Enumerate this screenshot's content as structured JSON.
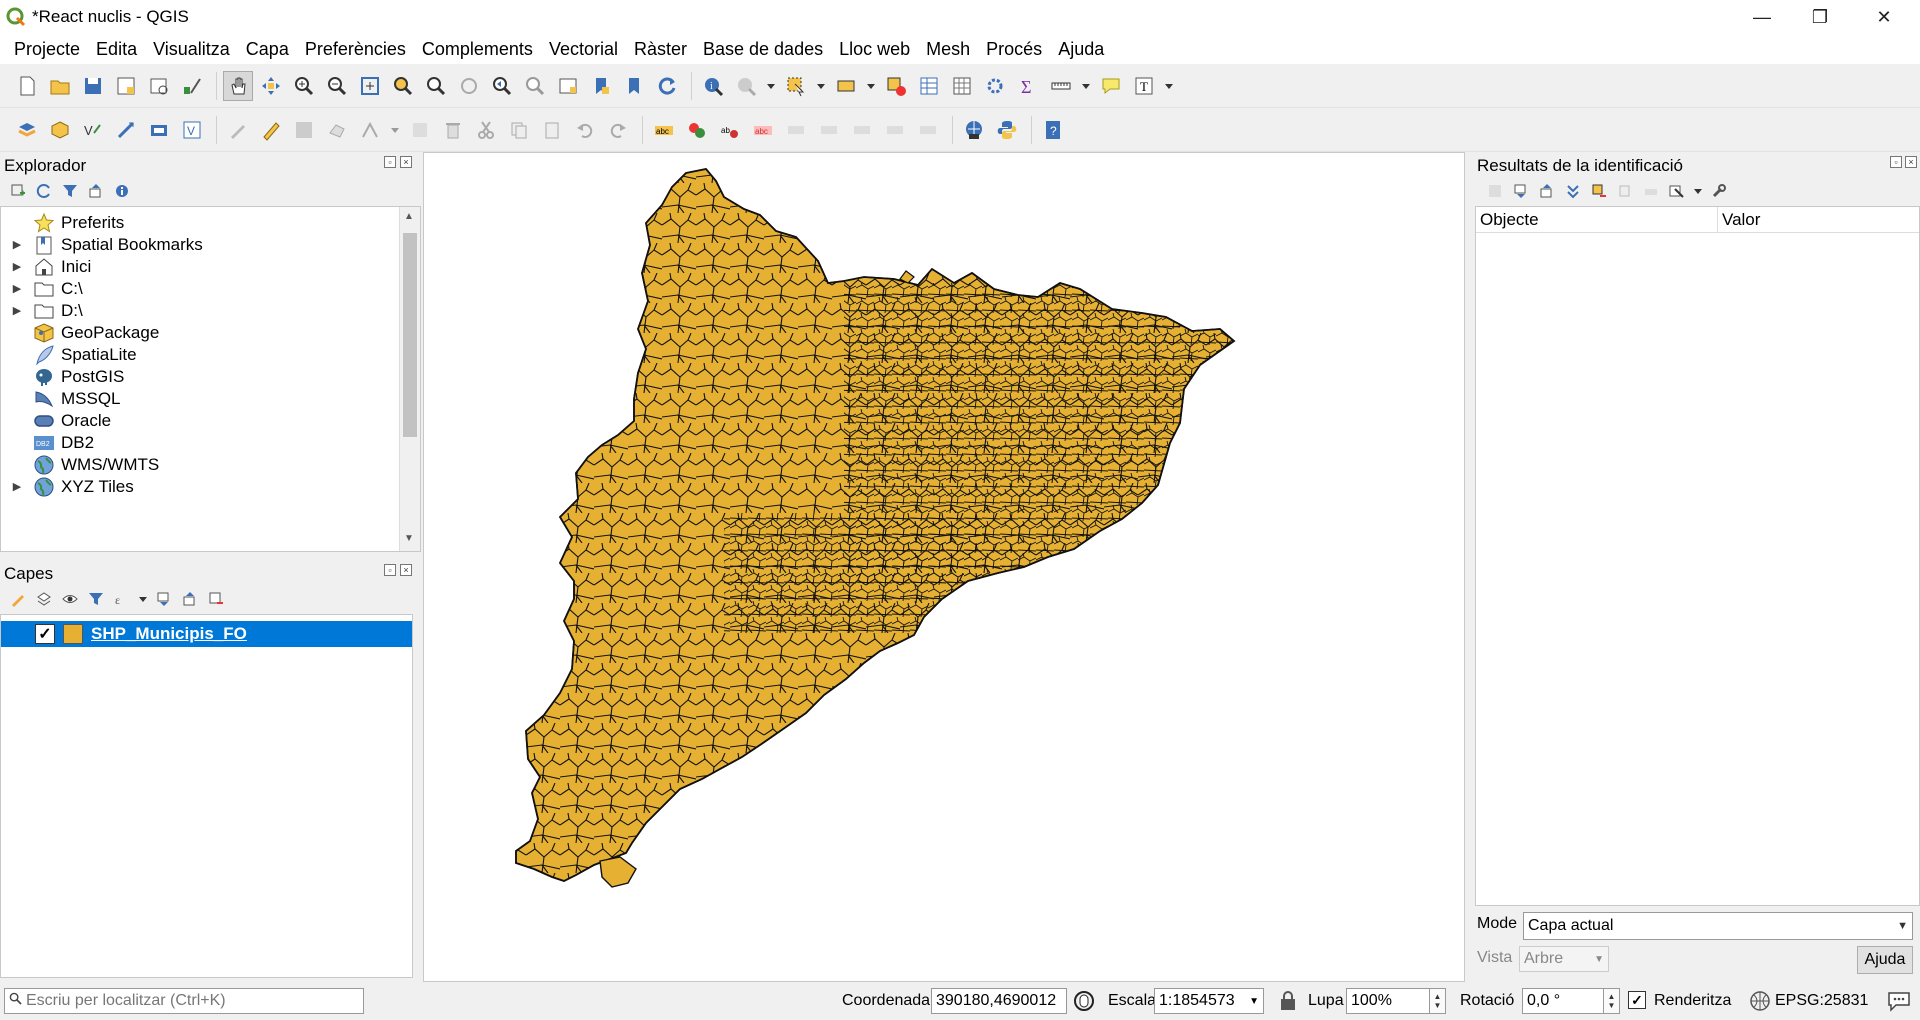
{
  "window": {
    "title": "*React nuclis - QGIS",
    "minimize": "—",
    "maximize": "❐",
    "close": "✕"
  },
  "menu": [
    "Projecte",
    "Edita",
    "Visualitza",
    "Capa",
    "Preferències",
    "Complements",
    "Vectorial",
    "Ràster",
    "Base de dades",
    "Lloc web",
    "Mesh",
    "Procés",
    "Ajuda"
  ],
  "browser": {
    "title": "Explorador",
    "items": [
      {
        "label": "Preferits",
        "expand": false,
        "icon": "star-icon"
      },
      {
        "label": "Spatial Bookmarks",
        "expand": true,
        "icon": "bookmark-icon"
      },
      {
        "label": "Inici",
        "expand": true,
        "icon": "home-folder-icon"
      },
      {
        "label": "C:\\",
        "expand": true,
        "icon": "folder-icon"
      },
      {
        "label": "D:\\",
        "expand": true,
        "icon": "folder-icon"
      },
      {
        "label": "GeoPackage",
        "expand": false,
        "icon": "geopackage-icon"
      },
      {
        "label": "SpatiaLite",
        "expand": false,
        "icon": "feather-icon"
      },
      {
        "label": "PostGIS",
        "expand": false,
        "icon": "elephant-icon"
      },
      {
        "label": "MSSQL",
        "expand": false,
        "icon": "mssql-icon"
      },
      {
        "label": "Oracle",
        "expand": false,
        "icon": "oracle-icon"
      },
      {
        "label": "DB2",
        "expand": false,
        "icon": "db2-icon"
      },
      {
        "label": "WMS/WMTS",
        "expand": false,
        "icon": "globe-icon"
      },
      {
        "label": "XYZ Tiles",
        "expand": true,
        "icon": "globe-icon"
      }
    ],
    "db2_badge": "DB2"
  },
  "layers": {
    "title": "Capes",
    "items": [
      {
        "name": "SHP_Municipis_FO",
        "checked": true,
        "color": "#e6b132"
      }
    ]
  },
  "identify": {
    "title": "Resultats de la identificació",
    "col_object": "Objecte",
    "col_value": "Valor",
    "mode_label": "Mode",
    "mode_value": "Capa actual",
    "view_label": "Vista",
    "view_value": "Arbre",
    "help": "Ajuda"
  },
  "status": {
    "search_placeholder": "Escriu per localitzar (Ctrl+K)",
    "coord_label": "Coordenada",
    "coord_value": "390180,4690012",
    "scale_label": "Escala",
    "scale_value": "1:1854573",
    "magnifier_label": "Lupa",
    "magnifier_value": "100%",
    "rotation_label": "Rotació",
    "rotation_value": "0,0 °",
    "render_label": "Renderitza",
    "render_checked": true,
    "crs": "EPSG:25831"
  },
  "colors": {
    "polygon_fill": "#e6b132",
    "selection": "#0078d7"
  }
}
